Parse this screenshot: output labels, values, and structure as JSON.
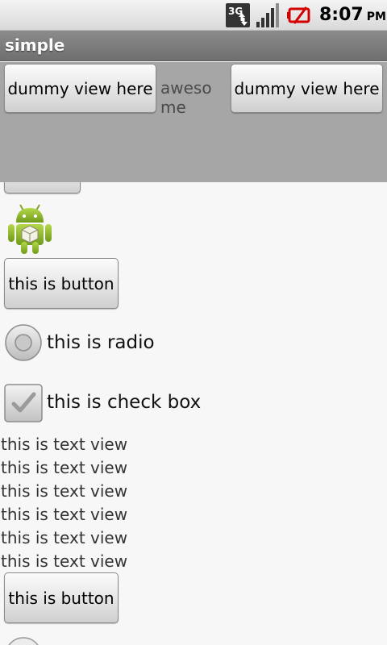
{
  "status_bar": {
    "time": "8:07",
    "ampm": "PM",
    "icons": [
      "3g-data-icon",
      "signal-icon",
      "battery-alert-icon"
    ],
    "network_label": "3G"
  },
  "app": {
    "title": "simple"
  },
  "overlay": {
    "left_button_label": "dummy view here",
    "center_text": "awesome",
    "right_button_label": "dummy view here",
    "background": "#a6a6a6"
  },
  "content": {
    "logo_icon": "android-logo-icon",
    "button1_label": "this is button",
    "radio_label": "this is radio",
    "radio_checked": false,
    "checkbox_label": "this is check box",
    "checkbox_checked": false,
    "text_views": [
      "this is text view",
      "this is text view",
      "this is text view",
      "this is text view",
      "this is text view",
      "this is text view"
    ],
    "button2_label": "this is button"
  }
}
